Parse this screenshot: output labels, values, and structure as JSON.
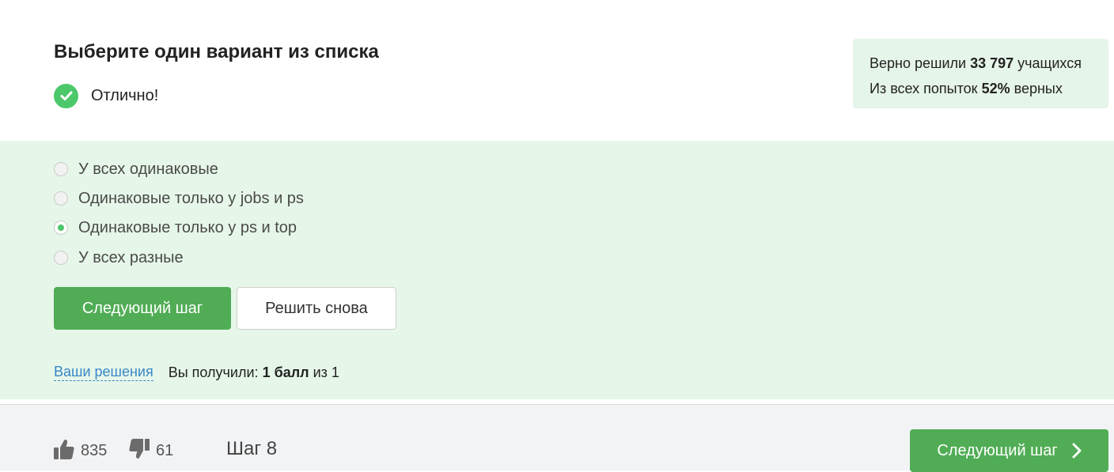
{
  "task": {
    "title": "Выберите один вариант из списка",
    "status": "Отлично!"
  },
  "stats": {
    "solved_prefix": "Верно решили",
    "solved_count": "33 797",
    "solved_suffix": "учащихся",
    "attempts_prefix": "Из всех попыток",
    "attempts_percent": "52%",
    "attempts_suffix": "верных"
  },
  "options": [
    {
      "label": "У всех одинаковые",
      "selected": false
    },
    {
      "label": "Одинаковые только у jobs и ps",
      "selected": false
    },
    {
      "label": "Одинаковые только у ps и top",
      "selected": true
    },
    {
      "label": "У всех разные",
      "selected": false
    }
  ],
  "actions": {
    "next_label": "Следующий шаг",
    "retry_label": "Решить снова"
  },
  "result": {
    "solutions_link": "Ваши решения",
    "prefix": "Вы получили:",
    "score": "1 балл",
    "suffix": "из 1"
  },
  "footer": {
    "likes": "835",
    "dislikes": "61",
    "step": "Шаг 8",
    "next_label": "Следующий шаг"
  },
  "colors": {
    "accent": "#50ad55",
    "success": "#4cc86b",
    "answer_bg": "#e6f7e9",
    "link": "#3a87c9"
  },
  "icons": {
    "status": "check-circle-icon",
    "like": "thumbs-up-icon",
    "dislike": "thumbs-down-icon",
    "next": "chevron-right-icon"
  }
}
